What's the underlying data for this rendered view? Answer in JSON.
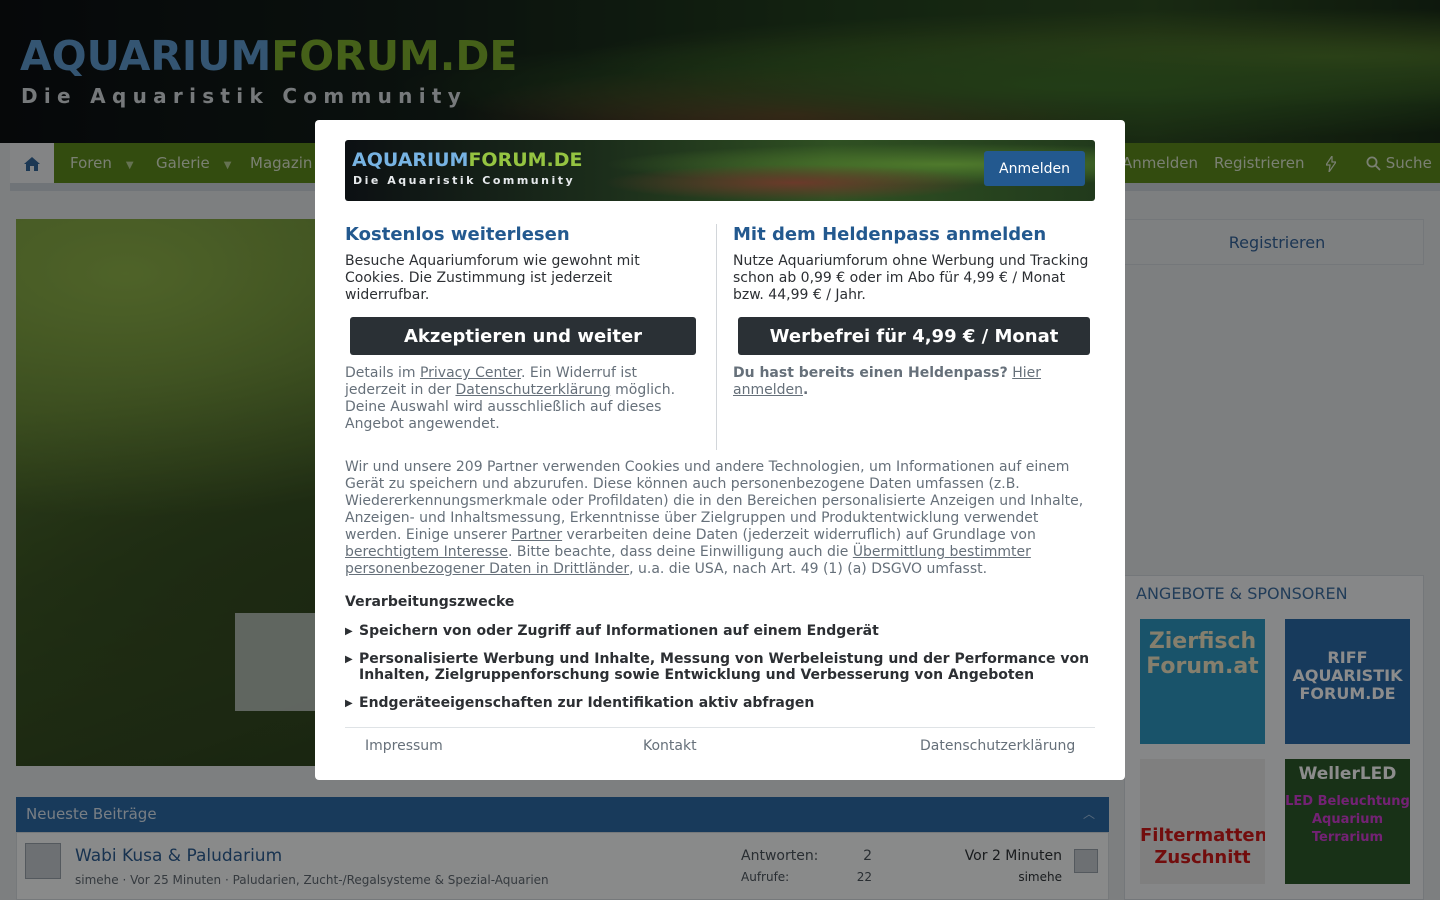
{
  "site": {
    "logo_part1": "AQUARIUM",
    "logo_part2": "FORUM.DE",
    "tagline": "Die Aquaristik Community"
  },
  "nav": {
    "home_icon": "home-icon",
    "items": [
      {
        "label": "Foren",
        "has_caret": true
      },
      {
        "label": "Galerie",
        "has_caret": true
      },
      {
        "label": "Magazin",
        "has_caret": false
      }
    ],
    "login": "Anmelden",
    "register": "Registrieren",
    "whats_new_icon": "bolt-icon",
    "search": "Suche",
    "accent": "#5d8a1c"
  },
  "sidebar": {
    "register": "Registrieren",
    "sponsors_title": "ANGEBOTE & SPONSOREN",
    "sponsors": [
      {
        "text": "Zierfisch Forum.at"
      },
      {
        "text": "RIFF AQUARISTIK FORUM.DE"
      },
      {
        "text": "Filtermatten Zuschnitt"
      },
      {
        "text": "WellerLED",
        "sub": "LED Beleuchtung Aquarium Terrarium"
      }
    ]
  },
  "latest": {
    "title": "Neueste Beiträge",
    "rows": [
      {
        "title": "Wabi Kusa & Paludarium",
        "author": "simehe",
        "time": "Vor 25 Minuten",
        "forum": "Paludarien, Zucht-/Regalsysteme & Spezial-Aquarien",
        "replies_label": "Antworten:",
        "replies": "2",
        "views_label": "Aufrufe:",
        "views": "22",
        "last_time": "Vor 2 Minuten",
        "last_user": "simehe"
      }
    ]
  },
  "modal": {
    "banner_logo_part1": "AQUARIUM",
    "banner_logo_part2": "FORUM.DE",
    "banner_tagline": "Die Aquaristik Community",
    "login_button": "Anmelden",
    "left": {
      "heading": "Kostenlos weiterlesen",
      "text": "Besuche Aquariumforum wie gewohnt mit Cookies. Die Zustimmung ist jederzeit widerrufbar.",
      "button": "Akzeptieren und weiter",
      "details_pre": "Details im ",
      "privacy_center": "Privacy Center",
      "details_mid": ". Ein Widerruf ist jederzeit in der ",
      "privacy_policy": "Datenschutzerklärung",
      "details_post": " möglich. Deine Auswahl wird ausschließlich auf dieses Angebot angewendet."
    },
    "right": {
      "heading": "Mit dem Heldenpass anmelden",
      "text": "Nutze Aquariumforum ohne Werbung und Tracking schon ab 0,99 € oder im Abo für 4,99 € / Monat bzw. 44,99 € / Jahr.",
      "button": "Werbefrei für 4,99 € / Monat",
      "have_pass": "Du hast bereits einen Heldenpass?",
      "login_here": "Hier anmelden",
      "period": "."
    },
    "policy": {
      "t1": "Wir und unsere 209 Partner verwenden Cookies und andere Technologien, um Informationen auf einem Gerät zu speichern und abzurufen. Diese können auch personenbezogene Daten umfassen (z.B. Wiedererkennungsmerkmale oder Profildaten) die in den Bereichen personalisierte Anzeigen und Inhalte, Anzeigen- und Inhaltsmessung, Erkenntnisse über Zielgruppen und Produktentwicklung verwendet werden. Einige unserer ",
      "partner": "Partner",
      "t2": " verarbeiten deine Daten (jederzeit widerruflich) auf Grundlage von ",
      "legit": "berechtigtem Interesse",
      "t3": ". Bitte beachte, dass deine Einwilligung auch die ",
      "transfer": "Übermittlung bestimmter personenbezogener Daten in Drittländer",
      "t4": ", u.a. die USA, nach Art. 49 (1) (a) DSGVO umfasst."
    },
    "purposes_heading": "Verarbeitungszwecke",
    "purposes": [
      "Speichern von oder Zugriff auf Informationen auf einem Endgerät",
      "Personalisierte Werbung und Inhalte, Messung von Werbeleistung und der Performance von Inhalten, Zielgruppenforschung sowie Entwicklung und Verbesserung von Angeboten",
      "Endgeräteeigenschaften zur Identifikation aktiv abfragen"
    ],
    "footer": {
      "imprint": "Impressum",
      "contact": "Kontakt",
      "privacy": "Datenschutzerklärung"
    }
  }
}
